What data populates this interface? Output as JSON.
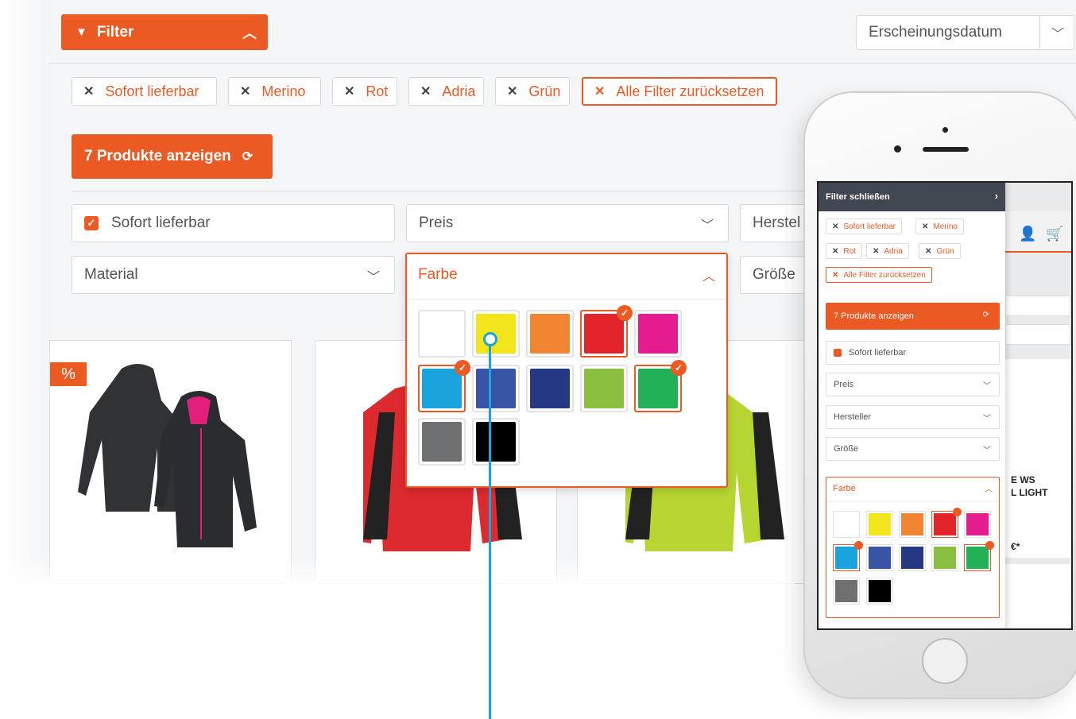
{
  "header": {
    "filter_label": "Filter",
    "sort_value": "Erscheinungsdatum"
  },
  "active_filters": [
    "Sofort lieferbar",
    "Merino",
    "Rot",
    "Adria",
    "Grün"
  ],
  "reset_label": "Alle Filter zurücksetzen",
  "show_products_label": "7 Produkte anzeigen",
  "facets": {
    "sofort": "Sofort lieferbar",
    "preis": "Preis",
    "hersteller": "Herstel",
    "material": "Material",
    "groesse": "Größe",
    "farbe": "Farbe"
  },
  "colors": {
    "accent": "#ec5a24",
    "pointer": "#1aa3dc",
    "swatches": [
      "#ffffff",
      "#f2e61b",
      "#f08431",
      "#e3242b",
      "#e51c90",
      "#1aa3dc",
      "#3954a6",
      "#253883",
      "#8bbf3f",
      "#22b156",
      "#6e7072",
      "#000000"
    ],
    "selected_swatches": [
      "#e3242b",
      "#1aa3dc",
      "#22b156"
    ]
  },
  "products": {
    "sale_badge": "%"
  },
  "mobile": {
    "drawer_title": "Filter schließen",
    "active_filters": [
      "Sofort lieferbar",
      "Merino",
      "Rot",
      "Adria",
      "Grün"
    ],
    "reset_label": "Alle Filter zurücksetzen",
    "show_products_label": "7 Produkte anzeigen",
    "facets": {
      "sofort": "Sofort lieferbar",
      "preis": "Preis",
      "hersteller": "Hersteller",
      "groesse": "Größe",
      "farbe": "Farbe"
    },
    "product_text_1": "E WS",
    "product_text_2": "L LIGHT",
    "price_text": "€*"
  },
  "icons": [
    "funnel-icon",
    "chevron-up-icon",
    "chevron-down-icon",
    "close-icon",
    "reload-icon",
    "check-icon",
    "user-icon",
    "cart-icon",
    "chevron-right-icon"
  ]
}
